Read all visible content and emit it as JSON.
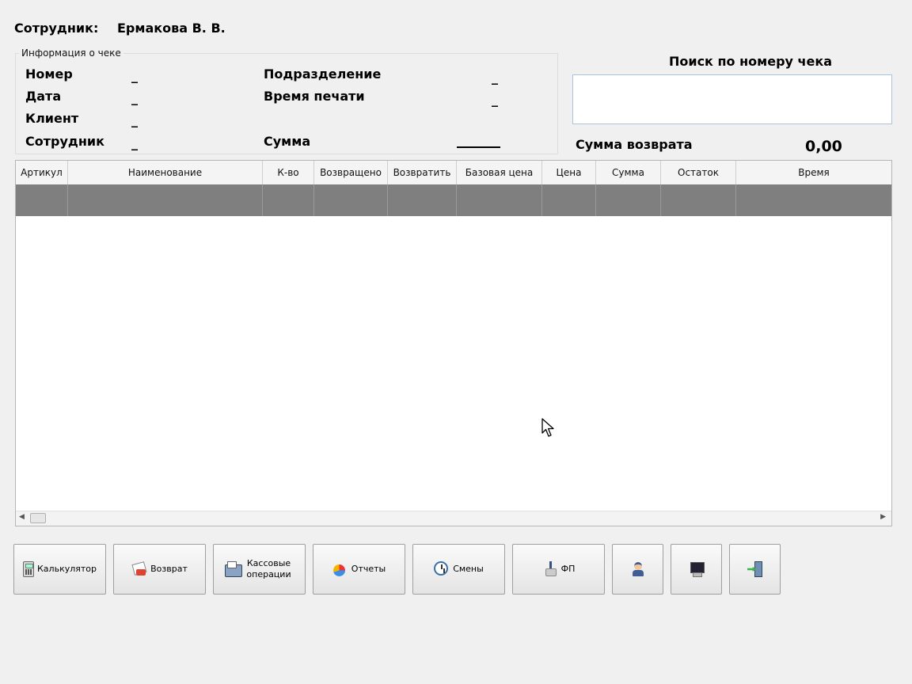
{
  "employee": {
    "label": "Сотрудник:",
    "name": "Ермакова В. В."
  },
  "receipt_info": {
    "group_title": "Информация о чеке",
    "number_label": "Номер",
    "number_value": "_",
    "date_label": "Дата",
    "date_value": "_",
    "client_label": "Клиент",
    "client_value": "_",
    "employee_label": "Сотрудник",
    "employee_value": "_",
    "department_label": "Подразделение",
    "department_value": "_",
    "print_time_label": "Время печати",
    "print_time_value": "_",
    "sum_label": "Сумма"
  },
  "search": {
    "title": "Поиск по номеру чека",
    "value": ""
  },
  "refund": {
    "label": "Сумма возврата",
    "value": "0,00"
  },
  "table": {
    "columns": [
      "Артикул",
      "Наименование",
      "К-во",
      "Возвращено",
      "Возвратить",
      "Базовая цена",
      "Цена",
      "Сумма",
      "Остаток",
      "Время"
    ]
  },
  "toolbar": {
    "calculator": "Калькулятор",
    "refund": "Возврат",
    "cash_ops": "Кассовые операции",
    "reports": "Отчеты",
    "shifts": "Смены",
    "fp": "ФП"
  },
  "icons": [
    "calculator-icon",
    "refund-icon",
    "cash-register-icon",
    "reports-icon",
    "clock-icon",
    "fiscal-printer-icon",
    "user-icon",
    "computer-icon",
    "exit-icon"
  ]
}
